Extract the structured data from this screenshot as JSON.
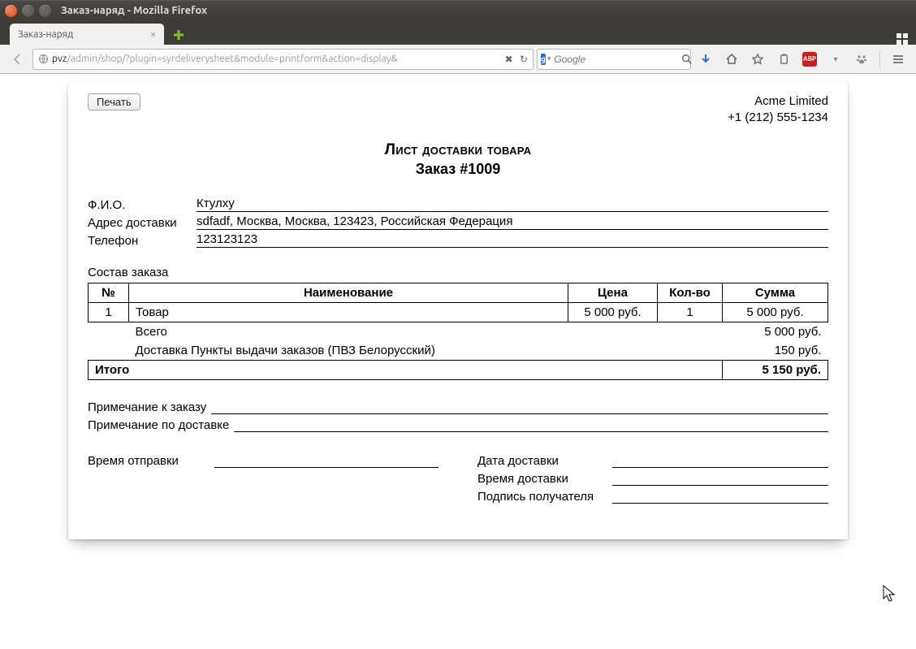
{
  "window": {
    "title": "Заказ-наряд - Mozilla Firefox"
  },
  "tab": {
    "title": "Заказ-наряд"
  },
  "url": {
    "domain": "pvz",
    "path": "/admin/shop/?plugin=syrdeliverysheet&module=printform&action=display&"
  },
  "search": {
    "engine_letter": "g",
    "placeholder": "Google"
  },
  "toolbar_icons": {
    "abp": "ABP"
  },
  "sheet": {
    "print_label": "Печать",
    "company": {
      "name": "Acme Limited",
      "phone": "+1 (212) 555-1234"
    },
    "title_line1": "Лист доставки товара",
    "title_line2": "Заказ #1009",
    "info": {
      "fio_label": "Ф.И.О.",
      "fio": "Ктулху",
      "addr_label": "Адрес доставки",
      "addr": "sdfadf, Москва, Москва, 123423, Российская Федерация",
      "phone_label": "Телефон",
      "phone": "123123123"
    },
    "items_heading": "Состав заказа",
    "columns": {
      "n": "№",
      "name": "Наименование",
      "price": "Цена",
      "qty": "Кол-во",
      "sum": "Сумма"
    },
    "items": [
      {
        "n": "1",
        "name": "Товар",
        "price": "5 000 руб.",
        "qty": "1",
        "sum": "5 000 руб."
      }
    ],
    "totals": {
      "subtotal_label": "Всего",
      "subtotal": "5 000 руб.",
      "shipping_label": "Доставка Пункты выдачи заказов (ПВЗ Белорусский)",
      "shipping": "150 руб.",
      "grand_label": "Итого",
      "grand": "5 150 руб."
    },
    "notes": {
      "order_note_label": "Примечание к заказу",
      "delivery_note_label": "Примечание по доставке"
    },
    "sign": {
      "dispatch_time_label": "Время отправки",
      "delivery_date_label": "Дата доставки",
      "delivery_time_label": "Время доставки",
      "signature_label": "Подпись получателя"
    }
  }
}
